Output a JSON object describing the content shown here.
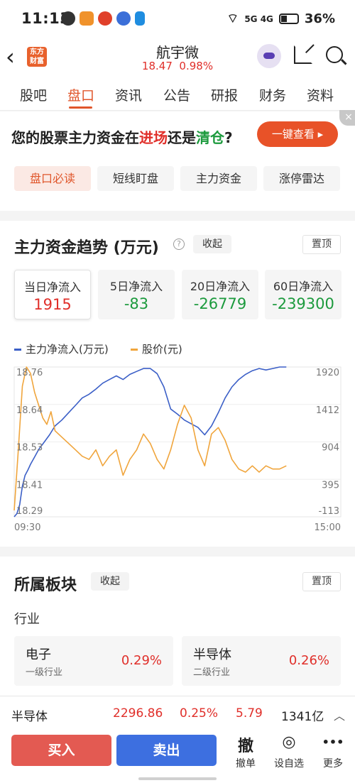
{
  "status": {
    "time": "11:13",
    "network": "5G 4G",
    "battery": "36%"
  },
  "header": {
    "logo_text": "东方财富",
    "stock_name": "航宇微",
    "price": "18.47",
    "change_pct": "0.98%"
  },
  "tabs": [
    "股吧",
    "盘口",
    "资讯",
    "公告",
    "研报",
    "财务",
    "资料"
  ],
  "promo": {
    "text_a": "您的股票主力资金在",
    "text_in": "进场",
    "text_b": "还是",
    "text_out": "清仓",
    "text_c": "?",
    "button": "一键查看 ▸",
    "close": "×",
    "chips": [
      "盘口必读",
      "短线盯盘",
      "主力资金",
      "涨停雷达"
    ]
  },
  "funds": {
    "title": "主力资金趋势 (万元)",
    "help": "?",
    "collapse": "收起",
    "pin": "置顶",
    "boxes": [
      {
        "label": "当日净流入",
        "value": "1915",
        "color": "#e02f2a"
      },
      {
        "label": "5日净流入",
        "value": "-83",
        "color": "#1c9a3d"
      },
      {
        "label": "20日净流入",
        "value": "-26779",
        "color": "#1c9a3d"
      },
      {
        "label": "60日净流入",
        "value": "-239300",
        "color": "#1c9a3d"
      }
    ]
  },
  "chart_data": {
    "type": "line",
    "series": [
      {
        "name": "主力净流入(万元)",
        "color": "#3b5fc7",
        "axis": "right",
        "x": [
          0,
          2,
          4,
          6,
          8,
          10,
          12,
          15,
          18,
          22,
          26,
          30,
          35,
          40,
          45,
          50,
          55,
          60,
          65,
          70,
          75,
          80,
          85,
          90,
          95,
          100,
          105,
          110,
          115,
          120,
          125,
          130,
          135,
          140,
          145,
          150,
          155,
          160,
          165,
          170,
          175,
          180,
          185,
          190,
          195,
          200
        ],
        "y": [
          -113,
          -70,
          50,
          300,
          450,
          520,
          600,
          700,
          800,
          900,
          1000,
          1120,
          1200,
          1300,
          1400,
          1500,
          1550,
          1620,
          1700,
          1750,
          1800,
          1750,
          1820,
          1860,
          1900,
          1900,
          1830,
          1650,
          1350,
          1280,
          1200,
          1150,
          1100,
          1000,
          1120,
          1300,
          1500,
          1650,
          1750,
          1820,
          1870,
          1900,
          1880,
          1900,
          1920,
          1920
        ]
      },
      {
        "name": "股价(元)",
        "color": "#f0a53c",
        "axis": "left",
        "x": [
          0,
          3,
          6,
          9,
          12,
          15,
          18,
          21,
          24,
          27,
          30,
          35,
          40,
          45,
          50,
          55,
          60,
          65,
          70,
          75,
          80,
          85,
          90,
          95,
          100,
          105,
          110,
          115,
          120,
          125,
          130,
          135,
          140,
          145,
          150,
          155,
          160,
          165,
          170,
          175,
          180,
          185,
          190,
          195,
          200
        ],
        "y": [
          18.31,
          18.5,
          18.7,
          18.76,
          18.74,
          18.68,
          18.64,
          18.6,
          18.58,
          18.62,
          18.56,
          18.54,
          18.52,
          18.5,
          18.48,
          18.47,
          18.5,
          18.45,
          18.48,
          18.5,
          18.42,
          18.47,
          18.5,
          18.55,
          18.52,
          18.47,
          18.44,
          18.5,
          18.58,
          18.64,
          18.6,
          18.5,
          18.45,
          18.55,
          18.57,
          18.53,
          18.47,
          18.44,
          18.43,
          18.45,
          18.43,
          18.45,
          18.44,
          18.44,
          18.45
        ]
      }
    ],
    "left_ticks": [
      "18.76",
      "18.64",
      "18.53",
      "18.41",
      "18.29"
    ],
    "right_ticks": [
      "1920",
      "1412",
      "904",
      "395",
      "-113"
    ],
    "ylim_left": [
      18.29,
      18.76
    ],
    "ylim_right": [
      -113,
      1920
    ],
    "x_start": "09:30",
    "x_end": "15:00",
    "xlim": [
      0,
      240
    ]
  },
  "sectors": {
    "title": "所属板块",
    "collapse": "收起",
    "pin": "置顶",
    "industry_label": "行业",
    "items": [
      {
        "name": "电子",
        "level": "一级行业",
        "pct": "0.29%"
      },
      {
        "name": "半导体",
        "level": "二级行业",
        "pct": "0.26%"
      }
    ]
  },
  "bottom": {
    "quote": {
      "name": "半导体",
      "index": "2296.86",
      "pct": "0.25%",
      "amt": "5.79",
      "vol": "1341亿"
    },
    "buy": "买入",
    "sell": "卖出",
    "actions": [
      {
        "icon": "撤",
        "label": "撤单"
      },
      {
        "icon": "◎",
        "label": "设自选"
      },
      {
        "icon": "•••",
        "label": "更多"
      }
    ]
  }
}
